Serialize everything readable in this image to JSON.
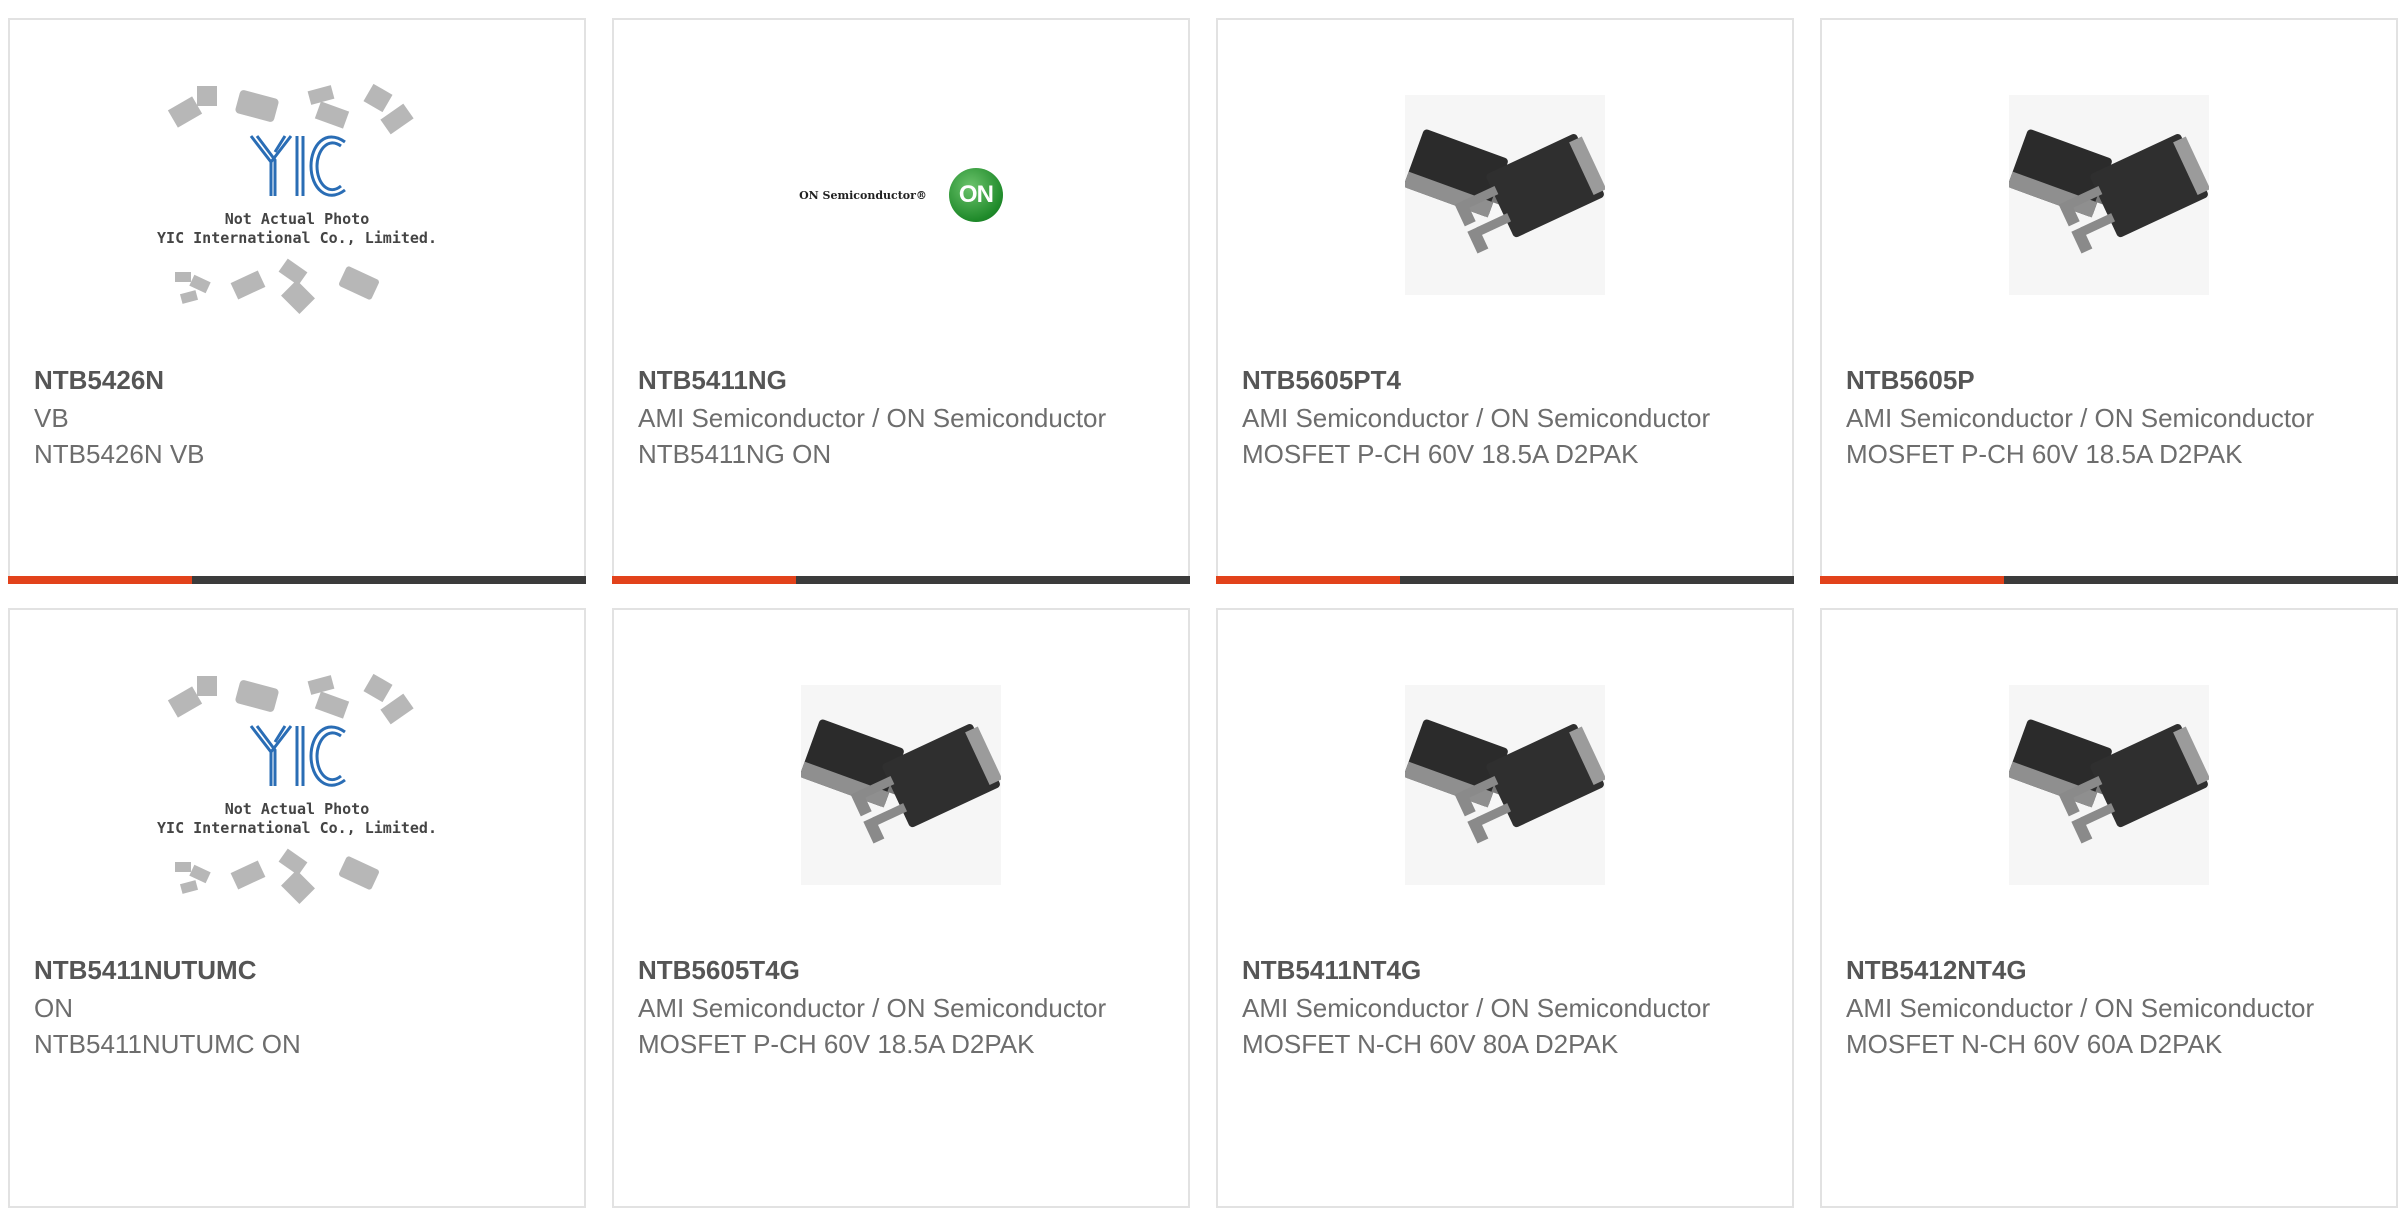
{
  "products": [
    {
      "part": "NTB5426N",
      "manufacturer": "VB",
      "description": "NTB5426N VB",
      "image": "yic-not-actual-photo",
      "image_note_line1": "Not Actual Photo",
      "image_note_line2": "YIC International Co., Limited."
    },
    {
      "part": "NTB5411NG",
      "manufacturer": "AMI Semiconductor / ON Semiconductor",
      "description": "NTB5411NG ON",
      "image": "on-semiconductor-logo",
      "logo_text": "ON Semiconductor®",
      "logo_badge": "ON"
    },
    {
      "part": "NTB5605PT4",
      "manufacturer": "AMI Semiconductor / ON Semiconductor",
      "description": "MOSFET P-CH 60V 18.5A D2PAK",
      "image": "d2pak-package"
    },
    {
      "part": "NTB5605P",
      "manufacturer": "AMI Semiconductor / ON Semiconductor",
      "description": "MOSFET P-CH 60V 18.5A D2PAK",
      "image": "d2pak-package"
    },
    {
      "part": "NTB5411NUTUMC",
      "manufacturer": "ON",
      "description": "NTB5411NUTUMC ON",
      "image": "yic-not-actual-photo",
      "image_note_line1": "Not Actual Photo",
      "image_note_line2": "YIC International Co., Limited."
    },
    {
      "part": "NTB5605T4G",
      "manufacturer": "AMI Semiconductor / ON Semiconductor",
      "description": "MOSFET P-CH 60V 18.5A D2PAK",
      "image": "d2pak-package"
    },
    {
      "part": "NTB5411NT4G",
      "manufacturer": "AMI Semiconductor / ON Semiconductor",
      "description": "MOSFET N-CH 60V 80A D2PAK",
      "image": "d2pak-package"
    },
    {
      "part": "NTB5412NT4G",
      "manufacturer": "AMI Semiconductor / ON Semiconductor",
      "description": "MOSFET N-CH 60V 60A D2PAK",
      "image": "d2pak-package"
    }
  ],
  "colors": {
    "accent": "#e2421b",
    "bar": "#3b3b3b",
    "border": "#e2e2e2",
    "text": "#6d6d6d",
    "yic_blue": "#2a6db5",
    "on_green": "#1f8a2a"
  }
}
